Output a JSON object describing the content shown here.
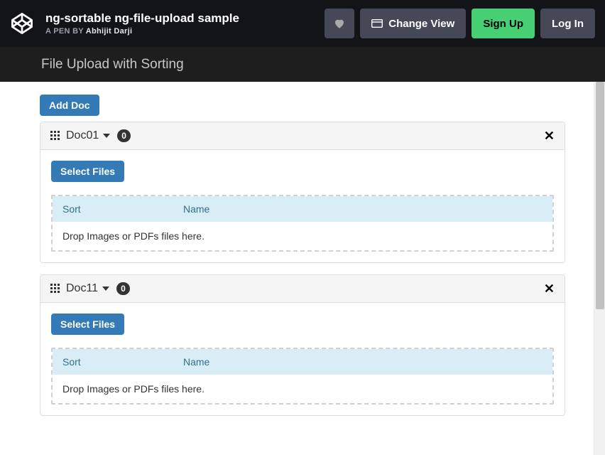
{
  "header": {
    "title": "ng-sortable ng-file-upload sample",
    "byline_prefix": "A PEN BY ",
    "author": "Abhijit Darji",
    "change_view": "Change View",
    "sign_up": "Sign Up",
    "log_in": "Log In"
  },
  "subheader": {
    "title": "File Upload with Sorting"
  },
  "toolbar": {
    "add_doc": "Add Doc"
  },
  "panel_labels": {
    "select_files": "Select Files",
    "sort_col": "Sort",
    "name_col": "Name",
    "drop_hint": "Drop Images or PDFs files here."
  },
  "docs": [
    {
      "title": "Doc01",
      "count": "0"
    },
    {
      "title": "Doc11",
      "count": "0"
    }
  ]
}
